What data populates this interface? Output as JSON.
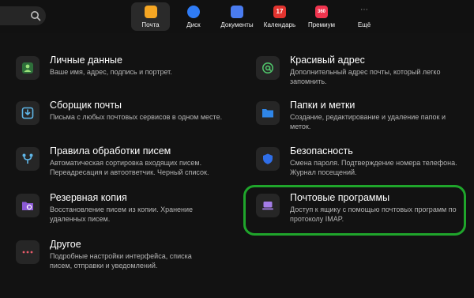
{
  "topbar": {
    "apps": [
      {
        "label": "Почта",
        "icon": "mail-icon",
        "color": "#f5a623"
      },
      {
        "label": "Диск",
        "icon": "disk-icon",
        "color": "#2f7cf6"
      },
      {
        "label": "Документы",
        "icon": "documents-icon",
        "color": "#4a7cf0"
      },
      {
        "label": "Календарь",
        "icon": "calendar-icon",
        "color": "#e3342f",
        "badge": "17"
      },
      {
        "label": "Премиум",
        "icon": "premium-icon",
        "color": "#f0344e",
        "badge": "360"
      },
      {
        "label": "Ещё",
        "icon": "more-icon",
        "color": "#888888"
      }
    ]
  },
  "settings": {
    "left": [
      {
        "title": "Личные данные",
        "desc": "Ваше имя, адрес, подпись и портрет.",
        "icon": "person-icon"
      },
      {
        "title": "Сборщик почты",
        "desc": "Письма с любых почтовых сервисов в одном месте.",
        "icon": "inbox-download-icon"
      },
      {
        "title": "Правила обработки писем",
        "desc": "Автоматическая сортировка входящих писем. Переадресация и автоответчик. Черный список.",
        "icon": "rules-icon"
      },
      {
        "title": "Резервная копия",
        "desc": "Восстановление писем из копии. Хранение удаленных писем.",
        "icon": "backup-folder-icon"
      },
      {
        "title": "Другое",
        "desc": "Подробные настройки интерфейса, списка писем, отправки и уведомлений.",
        "icon": "more-dots-icon"
      }
    ],
    "right": [
      {
        "title": "Красивый адрес",
        "desc": "Дополнительный адрес почты, который легко запомнить.",
        "icon": "at-icon"
      },
      {
        "title": "Папки и метки",
        "desc": "Создание, редактирование и удаление папок и меток.",
        "icon": "folder-icon"
      },
      {
        "title": "Безопасность",
        "desc": "Смена пароля. Подтверждение номера телефона. Журнал посещений.",
        "icon": "shield-icon"
      },
      {
        "title": "Почтовые программы",
        "desc": "Доступ к ящику с помощью почтовых программ по протоколу IMAP.",
        "icon": "mail-clients-icon"
      }
    ]
  },
  "colors": {
    "accent_green": "#1fa52b",
    "background": "#121212"
  }
}
